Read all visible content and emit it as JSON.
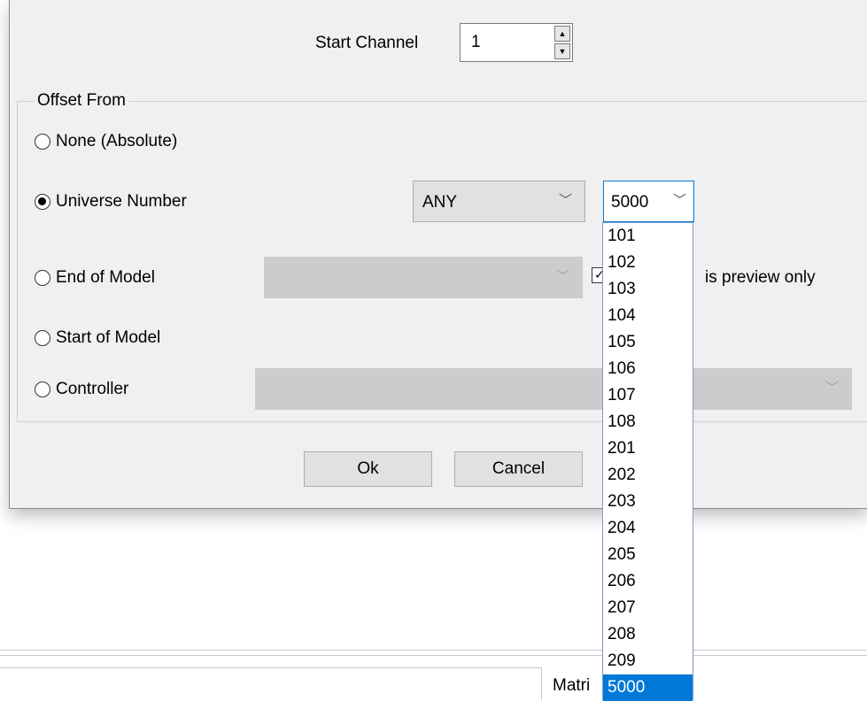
{
  "background": {
    "status_text": "Matri"
  },
  "dialog": {
    "start_channel": {
      "label": "Start Channel",
      "value": "1"
    },
    "offset_group": {
      "title": "Offset From",
      "options": [
        {
          "label": "None (Absolute)",
          "checked": false
        },
        {
          "label": "Universe Number",
          "checked": true
        },
        {
          "label": "End of Model",
          "checked": false
        },
        {
          "label": "Start of Model",
          "checked": false
        },
        {
          "label": "Controller",
          "checked": false
        }
      ]
    },
    "universe_protocol_combo": {
      "value": "ANY"
    },
    "universe_number_combo": {
      "value": "5000"
    },
    "preview_checkbox": {
      "label": "is preview only",
      "checked": true
    },
    "buttons": {
      "ok": "Ok",
      "cancel": "Cancel"
    }
  },
  "universe_dropdown": {
    "items": [
      "101",
      "102",
      "103",
      "104",
      "105",
      "106",
      "107",
      "108",
      "201",
      "202",
      "203",
      "204",
      "205",
      "206",
      "207",
      "208",
      "209",
      "5000"
    ],
    "selected": "5000"
  },
  "colors": {
    "accent": "#0078d7",
    "dialog_bg": "#f0f0f0",
    "disabled_combo": "#cccccc"
  }
}
